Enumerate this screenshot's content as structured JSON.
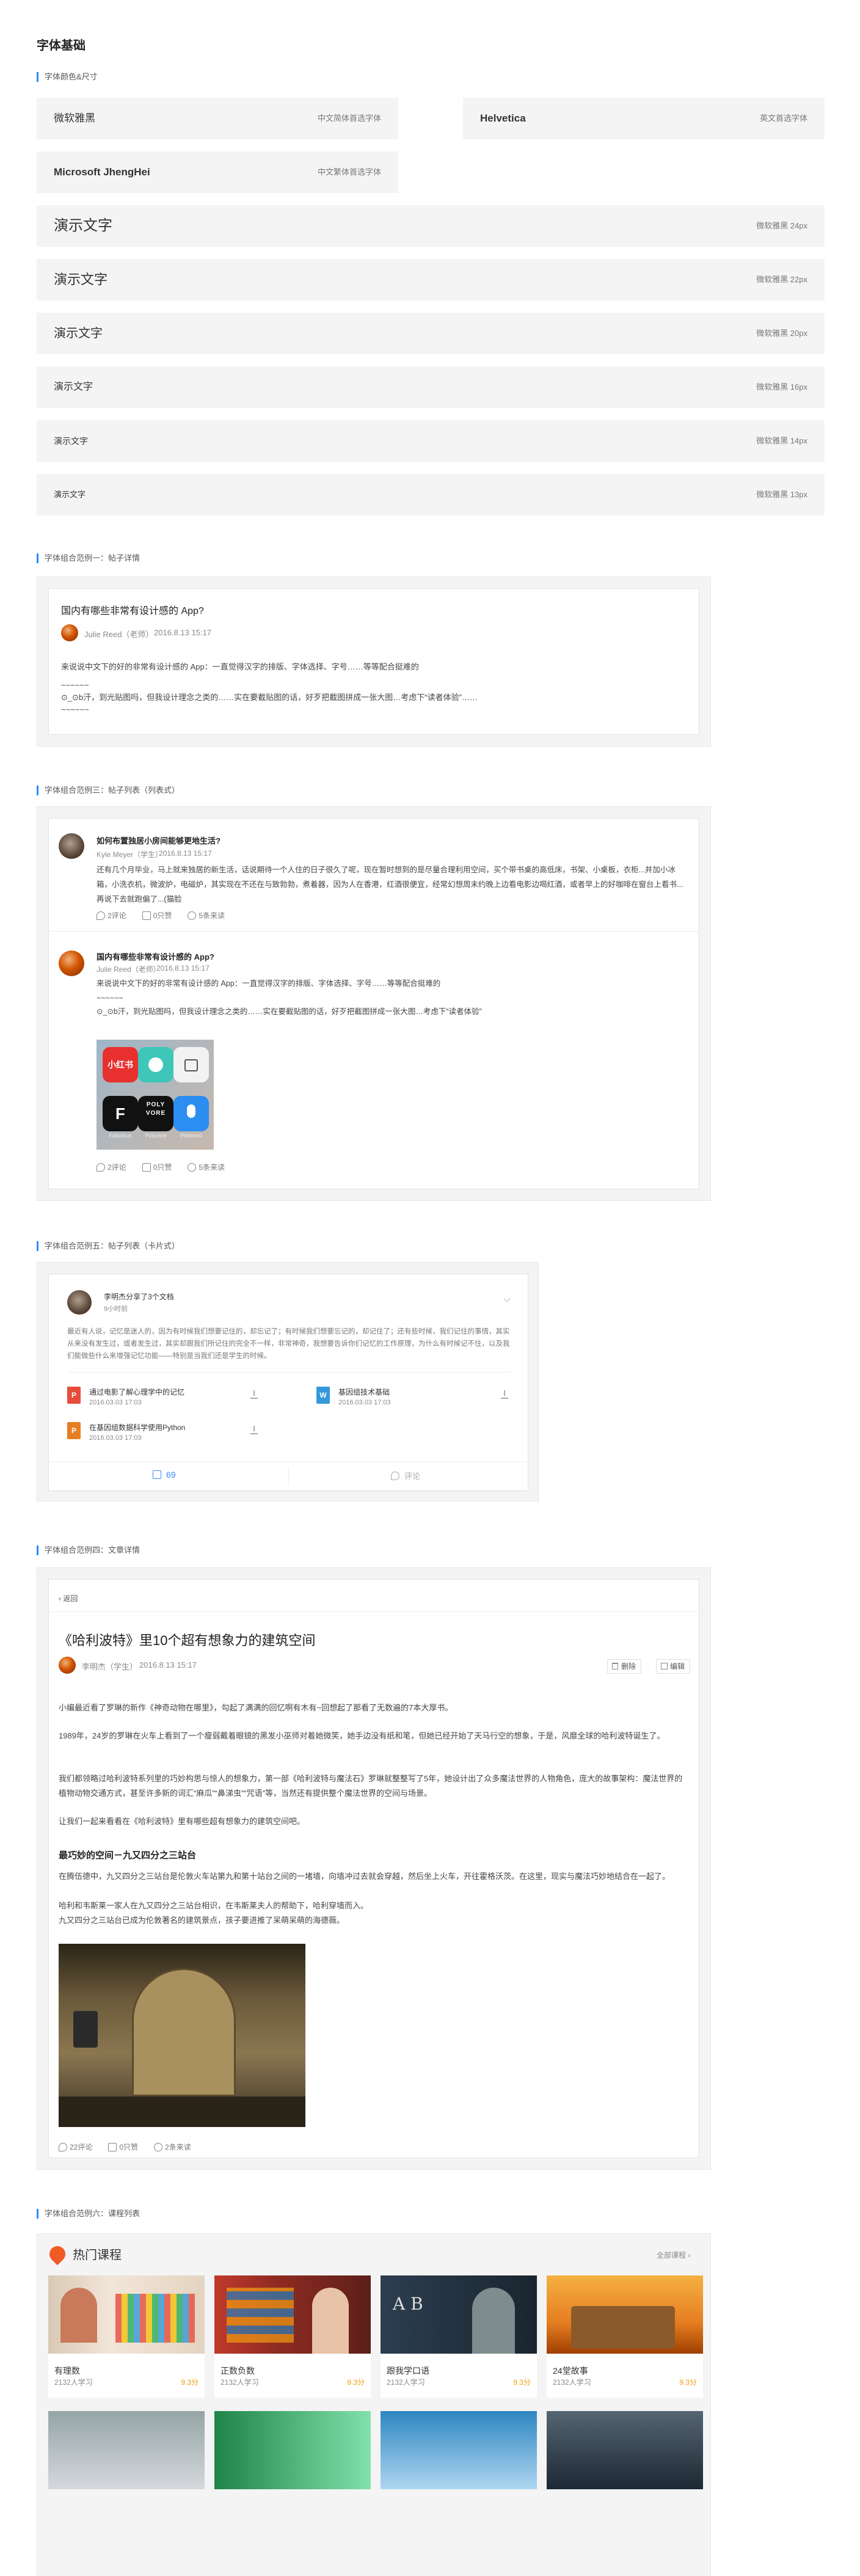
{
  "page_title": "字体基础",
  "sections": {
    "colors_sizes": "字体颜色&尺寸",
    "example1": "字体组合范例一：帖子详情",
    "example3": "字体组合范例三：帖子列表（列表式）",
    "example5": "字体组合范例五：帖子列表（卡片式）",
    "example4": "字体组合范例四：文章详情",
    "example6": "字体组合范例六：课程列表"
  },
  "font_samples": {
    "row1": [
      {
        "name": "微软雅黑",
        "desc": "中文简体首选字体"
      },
      {
        "name": "Helvetica",
        "desc": "英文首选字体"
      }
    ],
    "row2": {
      "name": "Microsoft JhengHei",
      "desc": "中文繁体首选字体"
    },
    "sizes": [
      {
        "text": "演示文字",
        "desc": "微软雅黑 24px"
      },
      {
        "text": "演示文字",
        "desc": "微软雅黑 22px"
      },
      {
        "text": "演示文字",
        "desc": "微软雅黑 20px"
      },
      {
        "text": "演示文字",
        "desc": "微软雅黑 16px"
      },
      {
        "text": "演示文字",
        "desc": "微软雅黑 14px"
      },
      {
        "text": "演示文字",
        "desc": "微软雅黑 13px"
      }
    ]
  },
  "post_detail": {
    "title": "国内有哪些非常有设计感的 App?",
    "author": "Julie Reed（老师）",
    "date": "2016.8.13 15:17",
    "line1": "来说说中文下的好的非常有设计感的 App：一直觉得汉字的排版、字体选择、字号……等等配合挺难的",
    "dash1": "~~~~~~",
    "line2": "⊙_⊙b汗，到光贴图吗，但我设计理念之类的……实在要截贴图的话，好歹把截图拼成一张大图…考虑下“读者体验”……",
    "dash2": "~~~~~~"
  },
  "post_list": {
    "item1": {
      "title": "如何布置独居小房间能够更地生活?",
      "author": "Kyle Meyer（学生）",
      "date": "2016.8.13 15:17",
      "body": "还有几个月毕业，马上就来独居的新生活，话说期待一个人住的日子很久了呢，现在暂时想到的是尽量合理利用空间，买个带书桌的高低床，书架、小桌板，衣柜...并加小冰箱，小洗衣机，微波炉，电磁炉，其实现在不还在与致勃勃，煮着器，因为人在香港，红酒很便宜，经常幻想周末约晚上边看电影边喝红酒，或者早上的好咖啡在窗台上看书...再说下去就跑偏了...(猫脸",
      "comments": "2评论",
      "likes": "0只赞",
      "shares": "5条来读"
    },
    "item2": {
      "title": "国内有哪些非常有设计感的 App?",
      "author": "Julie Reed（老师）",
      "date": "2016.8.13 15:17",
      "line1": "来说说中文下的好的非常有设计感的 App：一直觉得汉字的排版、字体选择、字号……等等配合挺难的",
      "dash1": "~~~~~~",
      "line2": "⊙_⊙b汗，到光贴图吗，但我设计理念之类的……实在要截贴图的话，好歹把截图拼成一张大图…考虑下“读者体验”",
      "apps": [
        "小红书",
        "",
        "",
        "Fabulous",
        "Polyvore",
        "Pinterest"
      ],
      "comments": "2评论",
      "likes": "0只赞",
      "shares": "5条来读"
    }
  },
  "card_list": {
    "author": "李明杰分享了3个文档",
    "time": "9小时前",
    "desc": "最近有人说，记忆是迷人的，因为有时候我们想要记住的，却忘记了；有时候我们想要忘记的，却记住了；还有些时候，我们记住的事情，其实从来没有发生过，或者发生过，其实却跟我们所记住的完全不一样，非常神奇，我想要告诉你们记忆的工作原理，为什么有时候记不住，以及我们能做些什么来增强记忆功能——特别是当我们还是学生的时候。",
    "files": [
      {
        "name": "通过电影了解心理学中的记忆",
        "meta": "2016.03.03  17:03",
        "color": "#e74c3c",
        "mark": "P"
      },
      {
        "name": "基因组技术基础",
        "meta": "2016.03.03  17:03",
        "color": "#3498db",
        "mark": "W"
      },
      {
        "name": "在基因组数据科学使用Python",
        "meta": "2016.03.03  17:03",
        "color": "#e67e22",
        "mark": "P"
      }
    ],
    "likes": "69",
    "comment_label": "评论"
  },
  "article": {
    "back": "返回",
    "title": "《哈利波特》里10个超有想象力的建筑空间",
    "author": "李明杰（学生）",
    "date": "2016.8.13 15:17",
    "delete": "删除",
    "edit": "编辑",
    "p1": "小编最近看了罗琳的新作《神奇动物在哪里》，勾起了满满的回忆啊有木有~回想起了那看了无数遍的7本大厚书。",
    "p2": "1989年，24岁的罗琳在火车上看到了一个瘦弱戴着眼镜的黑发小巫师对着她微笑，她手边没有纸和笔，但她已经开始了天马行空的想象，于是，风靡全球的哈利波特诞生了。",
    "p3": "我们都领略过哈利波特系列里的巧妙构思与惊人的想象力，第一部《哈利波特与魔法石》罗琳就整整写了5年，她设计出了众多魔法世界的人物角色，庞大的故事架构：魔法世界的植物动物交通方式，甚至许多新的词汇“麻瓜”“鼻涕虫”“咒语”等，当然还有提供整个魔法世界的空间与场景。",
    "p4": "让我们一起来看看在《哈利波特》里有哪些超有想象力的建筑空间吧。",
    "h2": "最巧妙的空间－九又四分之三站台",
    "p5a": "在腾伍德中，九又四分之三站台是伦敦火车站第九和第十站台之间的一堵墙，向墙冲过去就会穿越，然后坐上火车，开往霍格沃茨。在这里，现实与魔法巧妙地结合在一起了。",
    "p5b": "哈利和韦斯莱一家人在九又四分之三站台相识，在韦斯莱夫人的帮助下，哈利穿墙而入。",
    "p5c": "九又四分之三站台已成为伦敦著名的建筑景点，孩子要进推了呆萌呆萌的海德薇。",
    "comments": "22评论",
    "likes": "0只赞",
    "shares": "2条来读"
  },
  "courses": {
    "title": "热门课程",
    "all": "全部课程",
    "items": [
      {
        "name": "有理数",
        "stu": "2132人学习",
        "score": "9.3分"
      },
      {
        "name": "正数负数",
        "stu": "2132人学习",
        "score": "9.3分"
      },
      {
        "name": "跟我学口语",
        "stu": "2132人学习",
        "score": "9.3分"
      },
      {
        "name": "24堂故事",
        "stu": "2132人学习",
        "score": "9.3分"
      }
    ]
  }
}
